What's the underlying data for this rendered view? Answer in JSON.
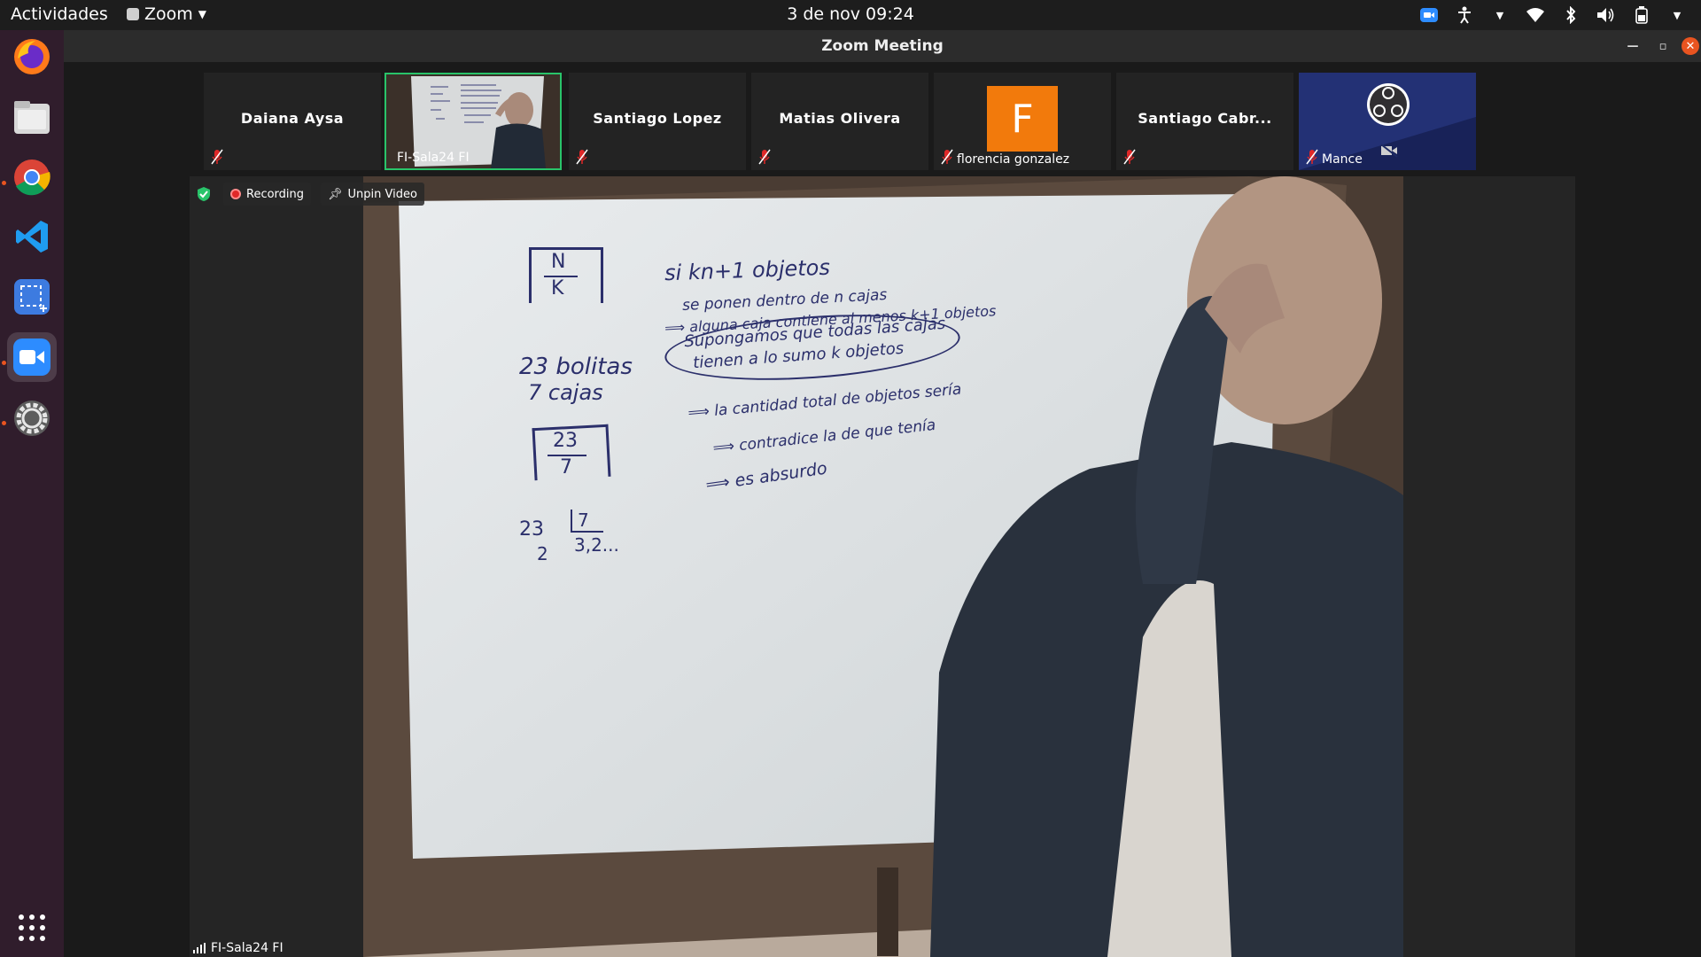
{
  "topbar": {
    "activities": "Actividades",
    "app_name": "Zoom",
    "clock": "3 de nov  09:24"
  },
  "window": {
    "title": "Zoom Meeting"
  },
  "participants": [
    {
      "name": "Daiana Aysa",
      "muted": true
    },
    {
      "name": "FI-Sala24 FI",
      "selected": true
    },
    {
      "name": "Santiago Lopez",
      "muted": true
    },
    {
      "name": "Matias Olivera",
      "muted": true
    },
    {
      "name": "florencia gonzalez",
      "avatar_letter": "F",
      "avatar_color": "#f27a0c",
      "muted": true
    },
    {
      "name": "Santiago Cabr...",
      "muted": true
    },
    {
      "name": "Mance",
      "muted": true,
      "video_off": true
    }
  ],
  "stage": {
    "recording_label": "Recording",
    "unpin_label": "Unpin Video",
    "speaker_label": "FI-Sala24 FI"
  },
  "whiteboard": {
    "ceil_fraction": {
      "num": "N",
      "den": "K"
    },
    "l1": "si  kn+1  objetos",
    "l2": "se ponen dentro de n cajas",
    "l3": "alguna caja contiene al menos k+1 objetos",
    "l4": "Supongamos que todas las cajas",
    "l5": "tienen a lo sumo k objetos",
    "l6": "la cantidad total de objetos sería",
    "l7": "contradice la  de que tenía",
    "l8": "es absurdo",
    "b1": "23 bolitas",
    "b2": "7  cajas",
    "frac2": {
      "num": "23",
      "den": "7"
    },
    "div_left": "23",
    "div_rem": "2",
    "div_right": "7",
    "div_quot": "3,2..."
  },
  "colors": {
    "accent_green": "#29c46a",
    "ubuntu_orange": "#e95420",
    "marker_blue": "#2b2f6b"
  }
}
